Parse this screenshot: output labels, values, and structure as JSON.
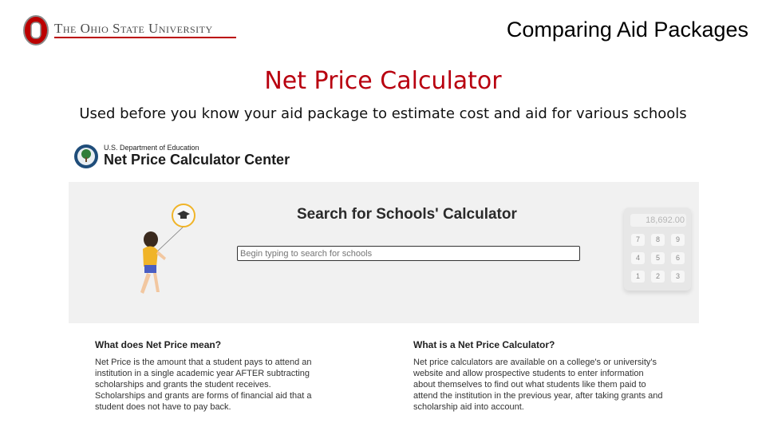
{
  "header": {
    "university_name": "The Ohio State University",
    "slide_title": "Comparing Aid Packages"
  },
  "section": {
    "heading": "Net Price Calculator",
    "subtitle": "Used before you know your aid package to estimate cost and aid for various schools"
  },
  "screenshot": {
    "department": "U.S. Department of Education",
    "site_title": "Net Price Calculator Center",
    "hero_title": "Search for Schools' Calculator",
    "search_placeholder": "Begin typing to search for schools",
    "calculator_display": "18,692.00",
    "calculator_keys": [
      "7",
      "8",
      "9",
      "4",
      "5",
      "6",
      "1",
      "2",
      "3"
    ],
    "left_panel": {
      "heading": "What does Net Price mean?",
      "lines": [
        "Net Price is the amount that a student pays to attend an",
        "institution in a single academic year AFTER subtracting",
        "scholarships and grants the student receives.",
        "Scholarships and grants are forms of financial aid that a",
        "student does not have to pay back."
      ]
    },
    "right_panel": {
      "heading": "What is a Net Price Calculator?",
      "lines": [
        "Net price calculators are available on a college's or university's",
        "website and allow prospective students to enter information",
        "about themselves to find out what students like them paid to",
        "attend the institution in the previous year, after taking grants and",
        "scholarship aid into account."
      ]
    }
  },
  "colors": {
    "osu_scarlet": "#bb0000",
    "heading_red": "#b8000f",
    "hero_background": "#f1f1f1"
  }
}
